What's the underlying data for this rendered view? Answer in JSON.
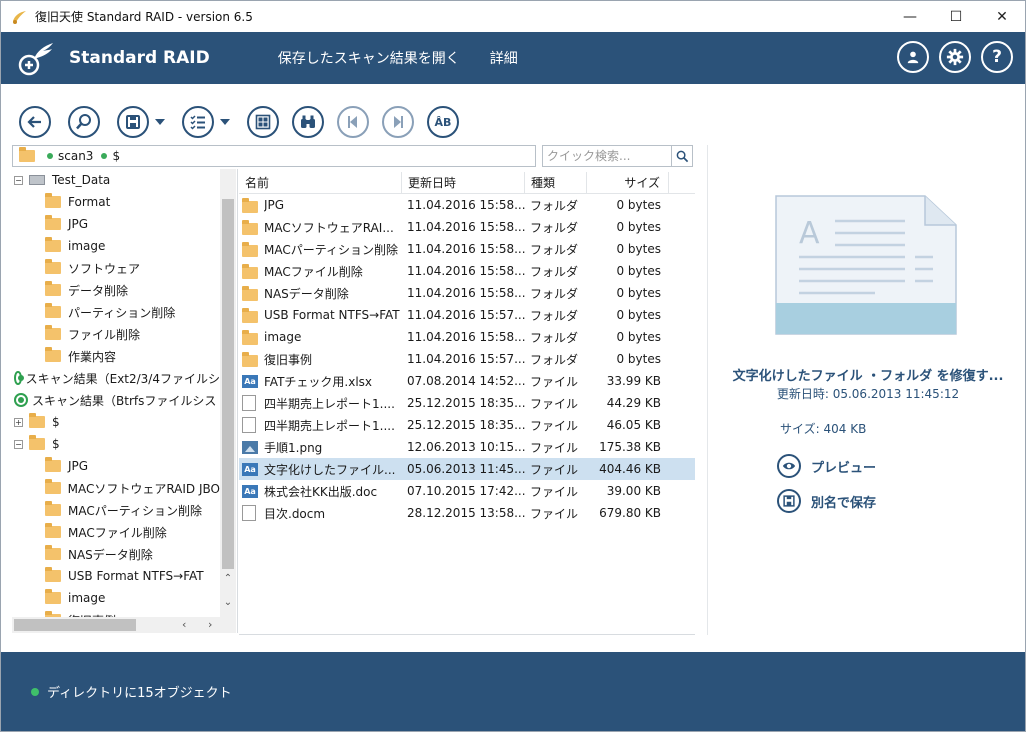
{
  "window": {
    "title": "復旧天使 Standard RAID - version 6.5",
    "minimize": "—",
    "maximize": "☐",
    "close": "✕"
  },
  "header": {
    "product": "Standard RAID",
    "nav": [
      "保存したスキャン結果を開く",
      "詳細"
    ],
    "icons": [
      "user-icon",
      "gear-icon",
      "help-icon"
    ],
    "help_glyph": "?"
  },
  "toolbar": {
    "buttons": [
      "back",
      "search",
      "save",
      "view-options",
      "grid-view",
      "find",
      "previous",
      "next",
      "filter-abc"
    ],
    "abc_label": "ÂB"
  },
  "path": {
    "segments": [
      "scan3",
      "$"
    ]
  },
  "search": {
    "placeholder": "クイック検索..."
  },
  "tree": {
    "items": [
      {
        "label": "Test_Data",
        "level": 0,
        "kind": "drive",
        "expander": "⊟"
      },
      {
        "label": "Format",
        "level": 1,
        "kind": "folder"
      },
      {
        "label": "JPG",
        "level": 1,
        "kind": "folder"
      },
      {
        "label": "image",
        "level": 1,
        "kind": "folder"
      },
      {
        "label": "ソフトウェア",
        "level": 1,
        "kind": "folder"
      },
      {
        "label": "データ削除",
        "level": 1,
        "kind": "folder"
      },
      {
        "label": "パーティション削除",
        "level": 1,
        "kind": "folder"
      },
      {
        "label": "ファイル削除",
        "level": 1,
        "kind": "folder"
      },
      {
        "label": "作業内容",
        "level": 1,
        "kind": "folder"
      },
      {
        "label": "スキャン結果（Ext2/3/4ファイルシ",
        "level": 0,
        "kind": "scan"
      },
      {
        "label": "スキャン結果（Btrfsファイルシス",
        "level": 0,
        "kind": "scan"
      },
      {
        "label": "$",
        "level": 0,
        "kind": "folder",
        "expander": "⊞"
      },
      {
        "label": "$",
        "level": 0,
        "kind": "folder",
        "expander": "⊟"
      },
      {
        "label": "JPG",
        "level": 1,
        "kind": "folder"
      },
      {
        "label": "MACソフトウェアRAID JBO",
        "level": 1,
        "kind": "folder"
      },
      {
        "label": "MACパーティション削除",
        "level": 1,
        "kind": "folder"
      },
      {
        "label": "MACファイル削除",
        "level": 1,
        "kind": "folder"
      },
      {
        "label": "NASデータ削除",
        "level": 1,
        "kind": "folder"
      },
      {
        "label": "USB Format NTFS→FAT",
        "level": 1,
        "kind": "folder"
      },
      {
        "label": "image",
        "level": 1,
        "kind": "folder"
      },
      {
        "label": "復旧事例",
        "level": 1,
        "kind": "folder"
      }
    ]
  },
  "filelist": {
    "columns": {
      "name": "名前",
      "date": "更新日時",
      "type": "種類",
      "size": "サイズ"
    },
    "rows": [
      {
        "name": "JPG",
        "date": "11.04.2016 15:58...",
        "type": "フォルダ",
        "size": "0 bytes",
        "icon": "folder"
      },
      {
        "name": "MACソフトウェアRAI...",
        "date": "11.04.2016 15:58...",
        "type": "フォルダ",
        "size": "0 bytes",
        "icon": "folder"
      },
      {
        "name": "MACパーティション削除",
        "date": "11.04.2016 15:58...",
        "type": "フォルダ",
        "size": "0 bytes",
        "icon": "folder"
      },
      {
        "name": "MACファイル削除",
        "date": "11.04.2016 15:58...",
        "type": "フォルダ",
        "size": "0 bytes",
        "icon": "folder"
      },
      {
        "name": "NASデータ削除",
        "date": "11.04.2016 15:58...",
        "type": "フォルダ",
        "size": "0 bytes",
        "icon": "folder"
      },
      {
        "name": "USB Format NTFS→FAT",
        "date": "11.04.2016 15:57...",
        "type": "フォルダ",
        "size": "0 bytes",
        "icon": "folder"
      },
      {
        "name": "image",
        "date": "11.04.2016 15:58...",
        "type": "フォルダ",
        "size": "0 bytes",
        "icon": "folder"
      },
      {
        "name": "復旧事例",
        "date": "11.04.2016 15:57...",
        "type": "フォルダ",
        "size": "0 bytes",
        "icon": "folder"
      },
      {
        "name": "FATチェック用.xlsx",
        "date": "07.08.2014 14:52...",
        "type": "ファイル",
        "size": "33.99 KB",
        "icon": "aa"
      },
      {
        "name": "四半期売上レポート1....",
        "date": "25.12.2015 18:35...",
        "type": "ファイル",
        "size": "44.29 KB",
        "icon": "doc"
      },
      {
        "name": "四半期売上レポート1....",
        "date": "25.12.2015 18:35...",
        "type": "ファイル",
        "size": "46.05 KB",
        "icon": "doc"
      },
      {
        "name": "手順1.png",
        "date": "12.06.2013 10:15...",
        "type": "ファイル",
        "size": "175.38 KB",
        "icon": "png"
      },
      {
        "name": "文字化けしたファイル...",
        "date": "05.06.2013 11:45...",
        "type": "ファイル",
        "size": "404.46 KB",
        "icon": "aa",
        "selected": true
      },
      {
        "name": "株式会社KK出版.doc",
        "date": "07.10.2015 17:42...",
        "type": "ファイル",
        "size": "39.00 KB",
        "icon": "aa"
      },
      {
        "name": "目次.docm",
        "date": "28.12.2015 13:58...",
        "type": "ファイル",
        "size": "679.80 KB",
        "icon": "doc"
      }
    ]
  },
  "preview": {
    "title": "文字化けしたファイル ・フォルダ を修復す...",
    "date_line": "更新日時: 05.06.2013 11:45:12",
    "size_line": "サイズ: 404 KB",
    "preview_label": "プレビュー",
    "save_as_label": "別名で保存"
  },
  "status": {
    "text": "ディレクトリに15オブジェクト"
  },
  "colors": {
    "brand": "#2b5279",
    "selection": "#cde0f0",
    "status_dot": "#3fc06a",
    "folder": "#f4c26b"
  }
}
